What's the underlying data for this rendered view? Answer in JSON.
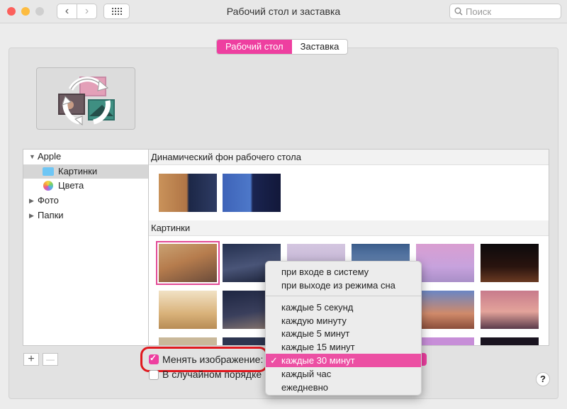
{
  "window": {
    "title": "Рабочий стол и заставка",
    "search_placeholder": "Поиск",
    "traffic_lights": {
      "close": "#fc605c",
      "minimize": "#fdbc40",
      "zoom": "#cfcfcf"
    }
  },
  "tabs": [
    {
      "label": "Рабочий стол",
      "active": true
    },
    {
      "label": "Заставка",
      "active": false
    }
  ],
  "sidebar": {
    "items": [
      {
        "label": "Apple",
        "expanded": true
      },
      {
        "label": "Картинки",
        "selected": true
      },
      {
        "label": "Цвета"
      },
      {
        "label": "Фото",
        "expanded": false
      },
      {
        "label": "Папки",
        "expanded": false
      }
    ]
  },
  "content": {
    "dynamic_header": "Динамический фон рабочего стола",
    "pictures_header": "Картинки"
  },
  "bottom": {
    "change_picture_label": "Менять изображение:",
    "change_picture_checked": true,
    "random_order_label": "В случайном порядке",
    "random_order_checked": false,
    "add_label": "+",
    "remove_label": "—",
    "help_label": "?"
  },
  "interval_menu": {
    "items": [
      "при входе в систему",
      "при выходе из режима сна",
      "каждые 5 секунд",
      "каждую минуту",
      "каждые 5 минут",
      "каждые 15 минут",
      "каждые 30 минут",
      "каждый час",
      "ежедневно"
    ],
    "selected": "каждые 30 минут",
    "checkmark": "✓"
  },
  "colors": {
    "accent": "#ee3fa0",
    "highlight_ring": "#e0191f"
  }
}
